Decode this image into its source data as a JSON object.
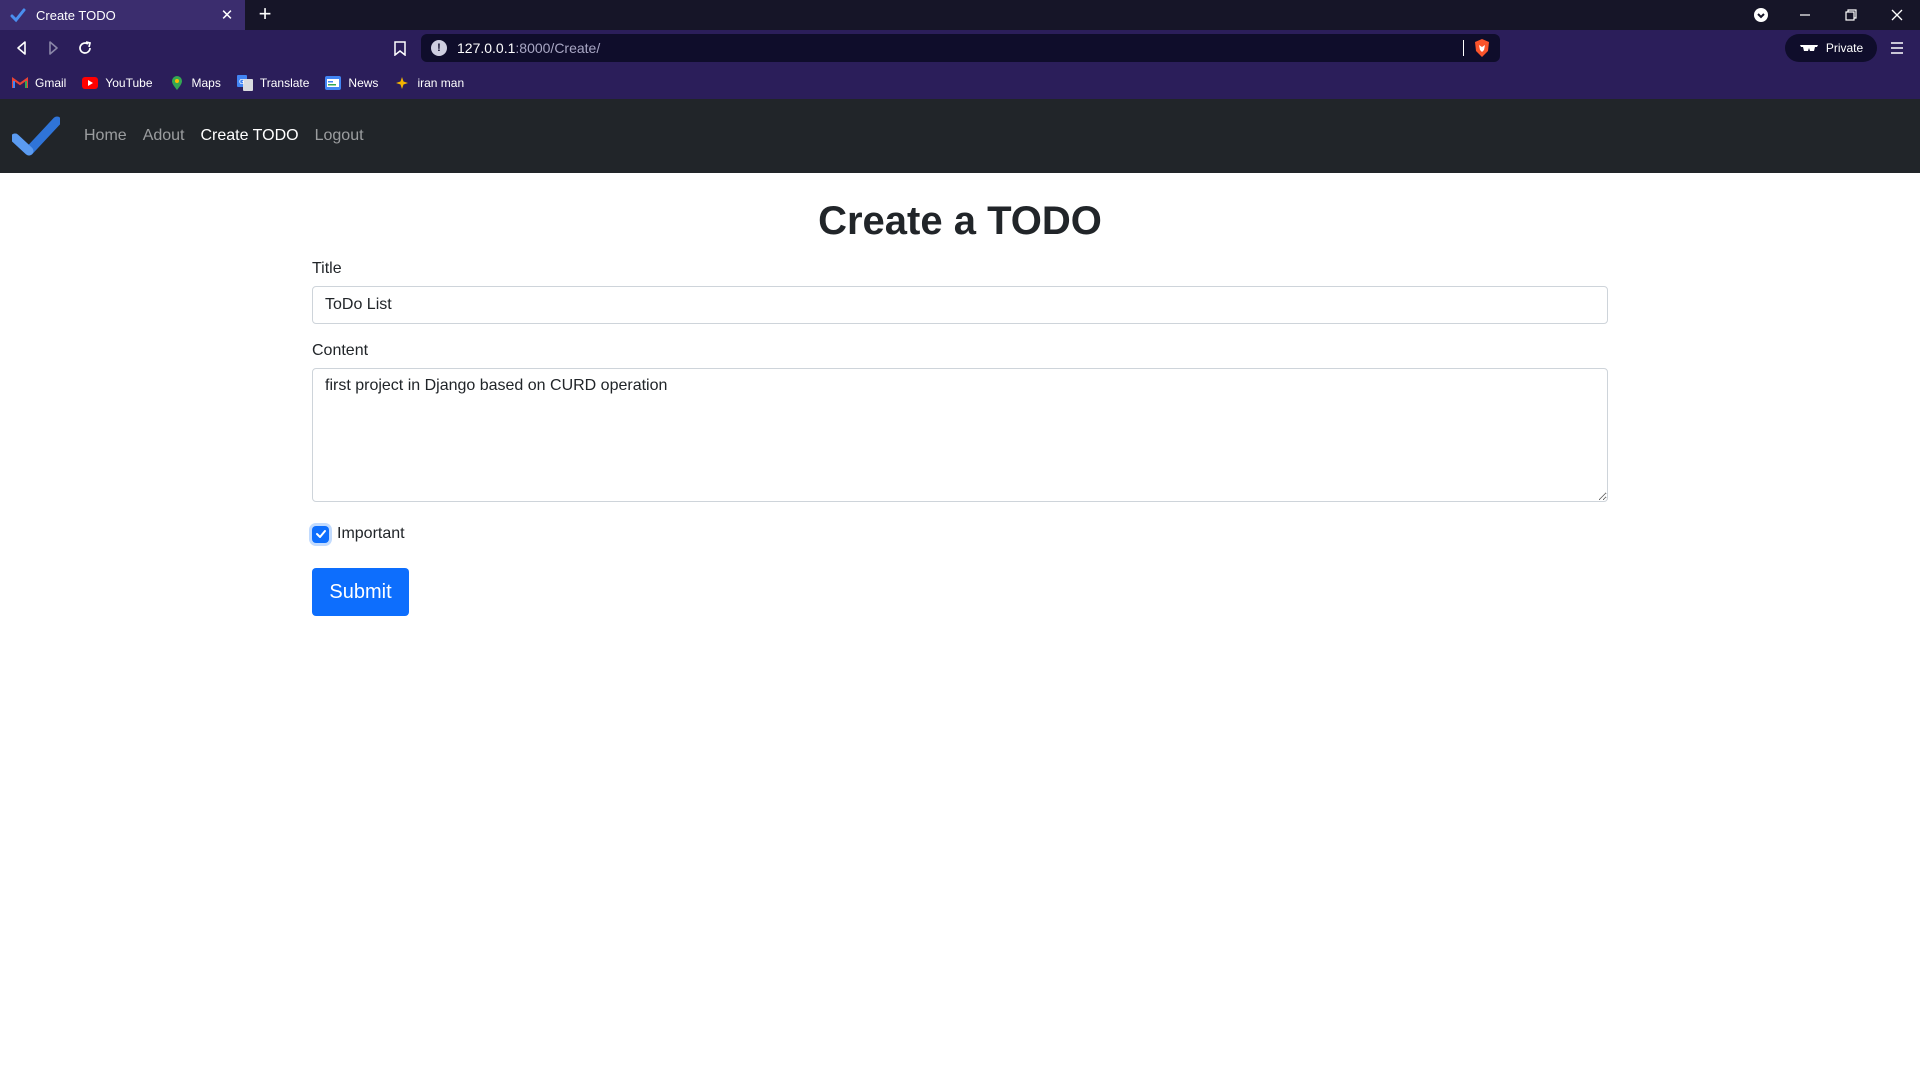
{
  "browser": {
    "tab": {
      "title": "Create TODO",
      "icon": "checkmark-icon"
    },
    "url": {
      "host": "127.0.0.1",
      "path": ":8000/Create/"
    },
    "private_label": "Private",
    "bookmarks": [
      {
        "label": "Gmail",
        "icon": "gmail-icon"
      },
      {
        "label": "YouTube",
        "icon": "youtube-icon"
      },
      {
        "label": "Maps",
        "icon": "maps-icon"
      },
      {
        "label": "Translate",
        "icon": "translate-icon"
      },
      {
        "label": "News",
        "icon": "news-icon"
      },
      {
        "label": "iran man",
        "icon": "bookmark-star-icon"
      }
    ]
  },
  "navbar": {
    "links": [
      {
        "label": "Home",
        "active": false
      },
      {
        "label": "Adout",
        "active": false
      },
      {
        "label": "Create TODO",
        "active": true
      },
      {
        "label": "Logout",
        "active": false
      }
    ]
  },
  "form": {
    "heading": "Create a TODO",
    "title_label": "Title",
    "title_value": "ToDo List",
    "content_label": "Content",
    "content_value": "first project in Django based on CURD operation",
    "important_label": "Important",
    "important_checked": true,
    "submit_label": "Submit"
  },
  "colors": {
    "primary": "#0d6efd",
    "navbar_bg": "#212529",
    "browser_toolbar": "#2b1e5a"
  }
}
